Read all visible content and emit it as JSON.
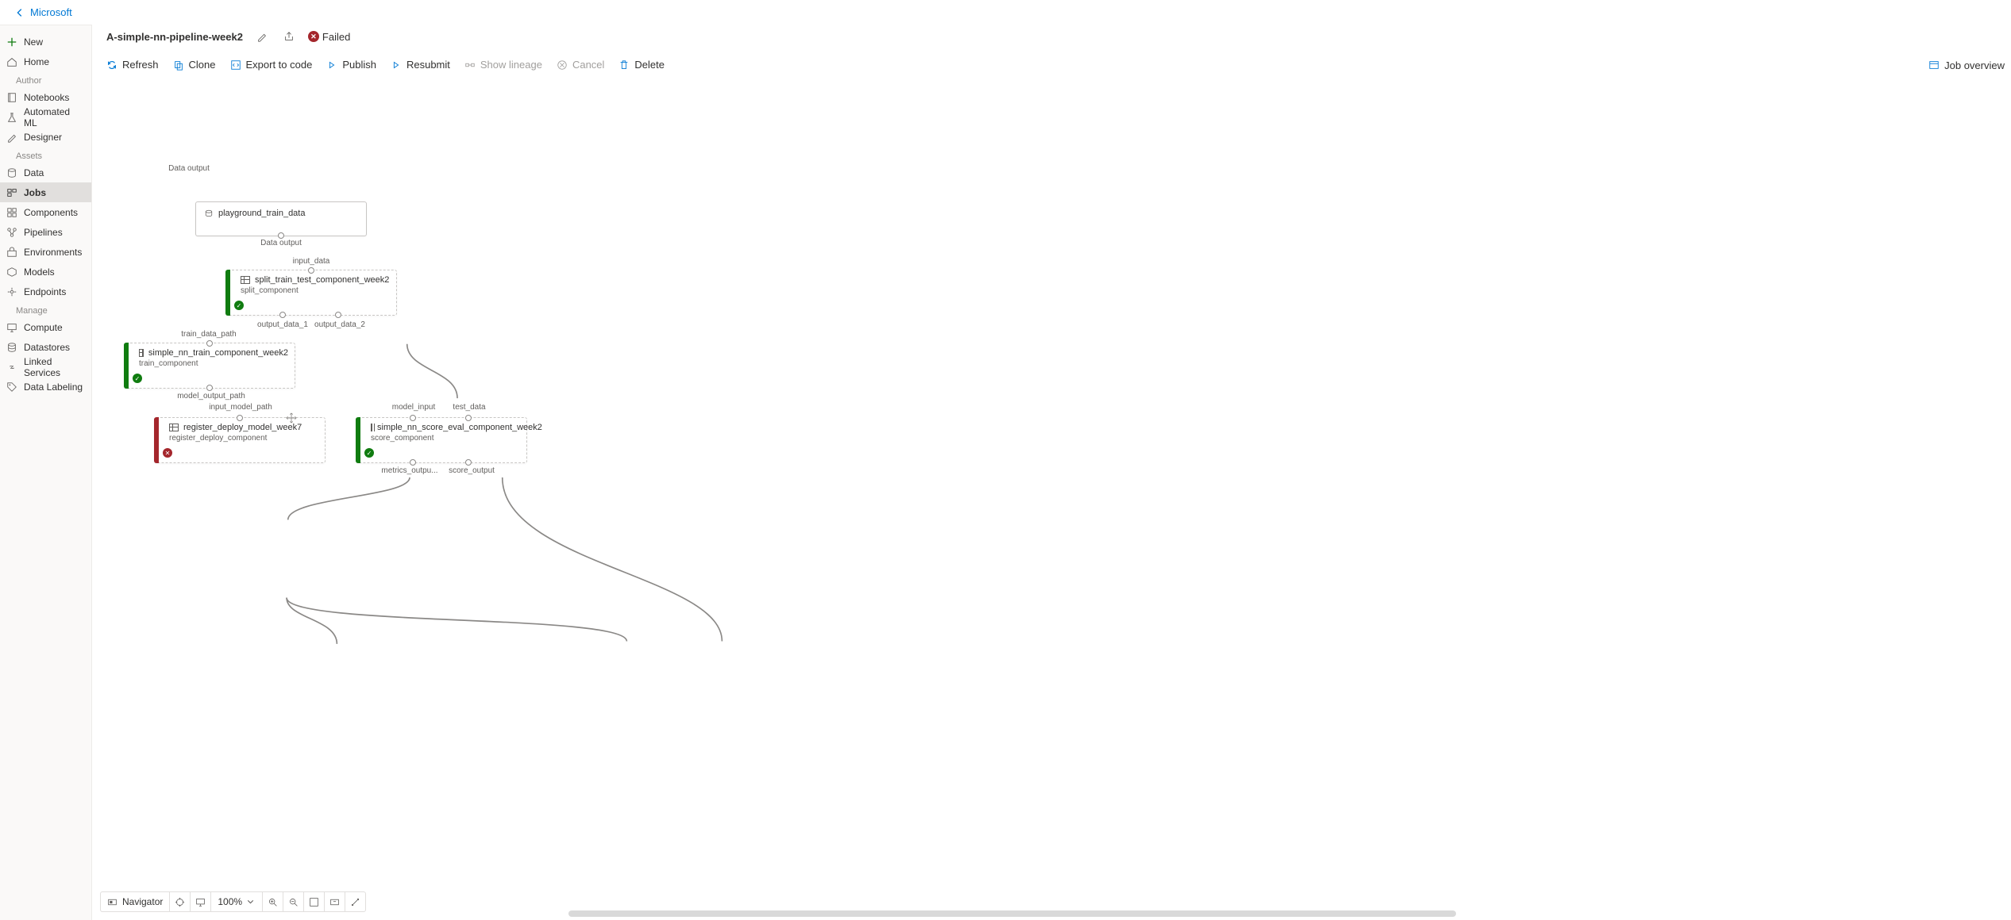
{
  "header": {
    "back": "Microsoft"
  },
  "sidebar": {
    "new": "New",
    "home": "Home",
    "sections": {
      "author": "Author",
      "assets": "Assets",
      "manage": "Manage"
    },
    "items": {
      "notebooks": "Notebooks",
      "automl": "Automated ML",
      "designer": "Designer",
      "data": "Data",
      "jobs": "Jobs",
      "components": "Components",
      "pipelines": "Pipelines",
      "environments": "Environments",
      "models": "Models",
      "endpoints": "Endpoints",
      "compute": "Compute",
      "datastores": "Datastores",
      "linked": "Linked Services",
      "labeling": "Data Labeling"
    }
  },
  "title": {
    "name": "A-simple-nn-pipeline-week2",
    "status": "Failed"
  },
  "toolbar": {
    "refresh": "Refresh",
    "clone": "Clone",
    "export_code": "Export to code",
    "publish": "Publish",
    "resubmit": "Resubmit",
    "lineage": "Show lineage",
    "cancel": "Cancel",
    "delete": "Delete",
    "job_overview": "Job overview"
  },
  "bottom": {
    "navigator": "Navigator",
    "zoom": "100%"
  },
  "nodes": {
    "n1": {
      "title": "playground_train_data",
      "out": "Data output"
    },
    "n2": {
      "in": "input_data",
      "title": "split_train_test_component_week2",
      "sub": "split_component",
      "out1": "output_data_1",
      "out2": "output_data_2"
    },
    "n3": {
      "in": "train_data_path",
      "title": "simple_nn_train_component_week2",
      "sub": "train_component",
      "out": "model_output_path"
    },
    "n4": {
      "in": "input_model_path",
      "title": "register_deploy_model_week7",
      "sub": "register_deploy_component"
    },
    "n5": {
      "in1": "model_input",
      "in2": "test_data",
      "title": "simple_nn_score_eval_component_week2",
      "sub": "score_component",
      "out1": "metrics_outpu...",
      "out2": "score_output"
    }
  }
}
